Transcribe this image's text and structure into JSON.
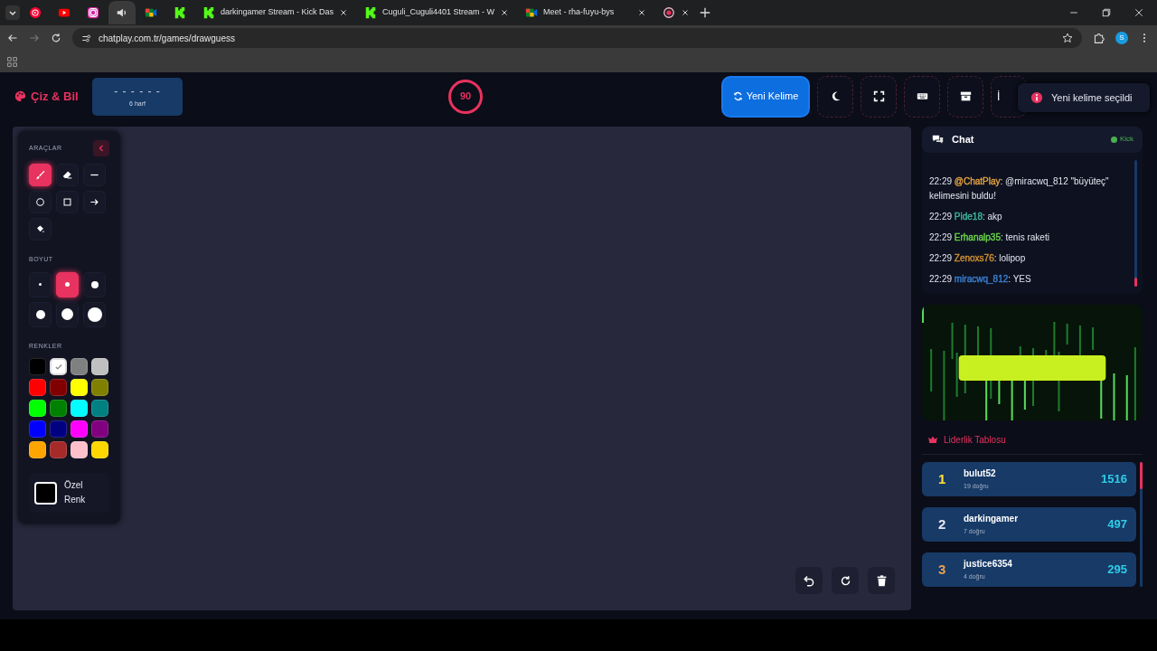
{
  "browser": {
    "tabs": [
      {
        "kind": "music",
        "selected": false
      },
      {
        "kind": "video",
        "selected": false
      },
      {
        "kind": "camera",
        "selected": false
      },
      {
        "kind": "audio",
        "selected": true
      },
      {
        "kind": "meet",
        "selected": false
      },
      {
        "kind": "kick",
        "selected": false
      },
      {
        "kind": "kick",
        "title": "darkingamer Stream - Kick Das",
        "selected": false
      },
      {
        "kind": "kick",
        "title": "Cuguli_Cuguli4401 Stream - W",
        "selected": false
      },
      {
        "kind": "meet",
        "title": "Meet - rha-fuyu-bys",
        "selected": false
      },
      {
        "kind": "record",
        "selected": false
      }
    ],
    "address": "chatplay.com.tr/games/drawguess",
    "profile": "S"
  },
  "header": {
    "logo": "Çiz & Bil",
    "word": {
      "mask": "- - - - - -",
      "hint": "6 harf"
    },
    "timer": "90",
    "new_word_button": "Yeni Kelime",
    "icon_buttons": [
      {
        "kind": "theme"
      },
      {
        "kind": "fullscreen"
      },
      {
        "kind": "keyboard"
      },
      {
        "kind": "archive"
      },
      {
        "kind": "text",
        "label": "İ"
      }
    ],
    "toast": "Yeni kelime seçildi"
  },
  "tool_panel": {
    "tools_title": "ARAÇLAR",
    "tools": [
      {
        "kind": "brush",
        "selected": true
      },
      {
        "kind": "eraser",
        "selected": false
      },
      {
        "kind": "line",
        "selected": false
      },
      {
        "kind": "circle",
        "selected": false
      },
      {
        "kind": "square",
        "selected": false
      },
      {
        "kind": "arrow",
        "selected": false
      },
      {
        "kind": "bucket",
        "selected": false
      }
    ],
    "size_title": "BOYUT",
    "sizes": [
      {
        "kind": "xs",
        "selected": false
      },
      {
        "kind": "s",
        "selected": true
      },
      {
        "kind": "m",
        "selected": false
      },
      {
        "kind": "l",
        "selected": false
      },
      {
        "kind": "xl",
        "selected": false
      },
      {
        "kind": "xxl",
        "selected": false
      }
    ],
    "colors_title": "RENKLER",
    "colors": [
      {
        "color": "#000000",
        "selected": false
      },
      {
        "color": "#ffffff",
        "selected": true
      },
      {
        "color": "#808080",
        "selected": false
      },
      {
        "color": "#c0c0c0",
        "selected": false
      },
      {
        "color": "#ff0000",
        "selected": false
      },
      {
        "color": "#800000",
        "selected": false
      },
      {
        "color": "#ffff00",
        "selected": false
      },
      {
        "color": "#808000",
        "selected": false
      },
      {
        "color": "#00ff00",
        "selected": false
      },
      {
        "color": "#008000",
        "selected": false
      },
      {
        "color": "#00ffff",
        "selected": false
      },
      {
        "color": "#008080",
        "selected": false
      },
      {
        "color": "#0000ff",
        "selected": false
      },
      {
        "color": "#000080",
        "selected": false
      },
      {
        "color": "#ff00ff",
        "selected": false
      },
      {
        "color": "#800080",
        "selected": false
      },
      {
        "color": "#ffa500",
        "selected": false
      },
      {
        "color": "#a52a2a",
        "selected": false
      },
      {
        "color": "#ffc0cb",
        "selected": false
      },
      {
        "color": "#ffd700",
        "selected": false
      }
    ],
    "custom_color": {
      "label": "Özel Renk",
      "color": "#000000"
    }
  },
  "canvas_actions": [
    {
      "kind": "undo"
    },
    {
      "kind": "redo"
    },
    {
      "kind": "delete"
    }
  ],
  "chat": {
    "title": "Chat",
    "source": {
      "label": "Kick",
      "color": "#4caf50"
    },
    "messages": [
      {
        "time": "22:29",
        "user": "@ChatPlay",
        "color": "#e0a040",
        "text": ": @miracwq_812 \"büyüteç\" kelimesini buldu!"
      },
      {
        "time": "22:29",
        "user": "Pide18",
        "color": "#3cb89a",
        "text": ": akp"
      },
      {
        "time": "22:29",
        "user": "Erhanalp35",
        "color": "#6ad44a",
        "text": ": tenis raketi"
      },
      {
        "time": "22:29",
        "user": "Zenoxs76",
        "color": "#d09030",
        "text": ": lolipop"
      },
      {
        "time": "22:29",
        "user": "miracwq_812",
        "color": "#3a7fd0",
        "text": ": YES"
      }
    ]
  },
  "leaderboard": {
    "title": "Liderlik Tablosu",
    "rows": [
      {
        "rank": "1",
        "color": "#ffe033",
        "name": "bulut52",
        "correct": "19 doğru",
        "score": "1516"
      },
      {
        "rank": "2",
        "color": "#e6e6f0",
        "name": "darkingamer",
        "correct": "7 doğru",
        "score": "497"
      },
      {
        "rank": "3",
        "color": "#e8a050",
        "name": "justice6354",
        "correct": "4 doğru",
        "score": "295"
      }
    ]
  }
}
